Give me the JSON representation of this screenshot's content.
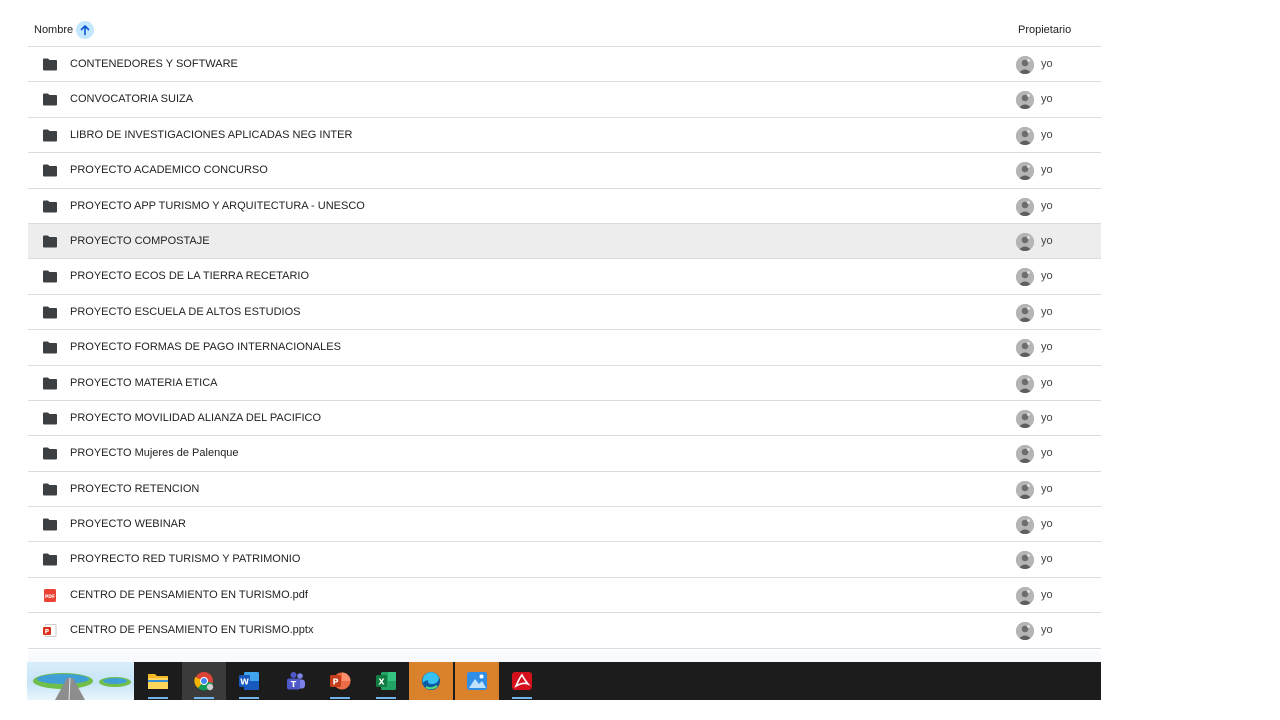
{
  "header": {
    "name_label": "Nombre",
    "owner_label": "Propietario",
    "sort_icon": "arrow-up-icon",
    "sort_color": "#c2e7ff"
  },
  "files": [
    {
      "name": "CONTENEDORES Y SOFTWARE",
      "type": "folder",
      "owner": "yo"
    },
    {
      "name": "CONVOCATORIA SUIZA",
      "type": "folder",
      "owner": "yo"
    },
    {
      "name": "LIBRO DE INVESTIGACIONES APLICADAS NEG INTER",
      "type": "folder",
      "owner": "yo"
    },
    {
      "name": "PROYECTO ACADEMICO CONCURSO",
      "type": "folder",
      "owner": "yo"
    },
    {
      "name": "PROYECTO APP TURISMO Y ARQUITECTURA - UNESCO",
      "type": "folder",
      "owner": "yo"
    },
    {
      "name": "PROYECTO COMPOSTAJE",
      "type": "folder",
      "owner": "yo",
      "selected": true
    },
    {
      "name": "PROYECTO ECOS DE LA TIERRA RECETARIO",
      "type": "folder",
      "owner": "yo"
    },
    {
      "name": "PROYECTO ESCUELA DE ALTOS ESTUDIOS",
      "type": "folder",
      "owner": "yo"
    },
    {
      "name": "PROYECTO FORMAS DE PAGO INTERNACIONALES",
      "type": "folder",
      "owner": "yo"
    },
    {
      "name": "PROYECTO MATERIA ETICA",
      "type": "folder",
      "owner": "yo"
    },
    {
      "name": "PROYECTO MOVILIDAD ALIANZA DEL PACIFICO",
      "type": "folder",
      "owner": "yo"
    },
    {
      "name": "PROYECTO Mujeres de Palenque",
      "type": "folder",
      "owner": "yo"
    },
    {
      "name": "PROYECTO RETENCION",
      "type": "folder",
      "owner": "yo"
    },
    {
      "name": "PROYECTO WEBINAR",
      "type": "folder",
      "owner": "yo"
    },
    {
      "name": "PROYRECTO RED TURISMO Y PATRIMONIO",
      "type": "folder",
      "owner": "yo"
    },
    {
      "name": "CENTRO DE PENSAMIENTO EN TURISMO.pdf",
      "type": "pdf",
      "owner": "yo"
    },
    {
      "name": "CENTRO DE PENSAMIENTO EN TURISMO.pptx",
      "type": "pptx",
      "owner": "yo"
    }
  ],
  "colors": {
    "folder": "#3c4043",
    "pdf": "#ea4335",
    "pptx": "#d9301e",
    "selected_row": "#ededed",
    "divider": "#dadce0"
  },
  "taskbar": {
    "apps": [
      {
        "icon": "file-explorer-icon",
        "running": true
      },
      {
        "icon": "chrome-icon",
        "running": true,
        "active": true
      },
      {
        "icon": "word-icon",
        "running": true
      },
      {
        "icon": "teams-icon",
        "running": false
      },
      {
        "icon": "powerpoint-icon",
        "running": true
      },
      {
        "icon": "excel-icon",
        "running": true
      },
      {
        "icon": "edge-icon",
        "running": false,
        "highlight": true
      },
      {
        "icon": "photos-icon",
        "running": false,
        "highlight": true
      },
      {
        "icon": "acrobat-icon",
        "running": true
      }
    ]
  }
}
